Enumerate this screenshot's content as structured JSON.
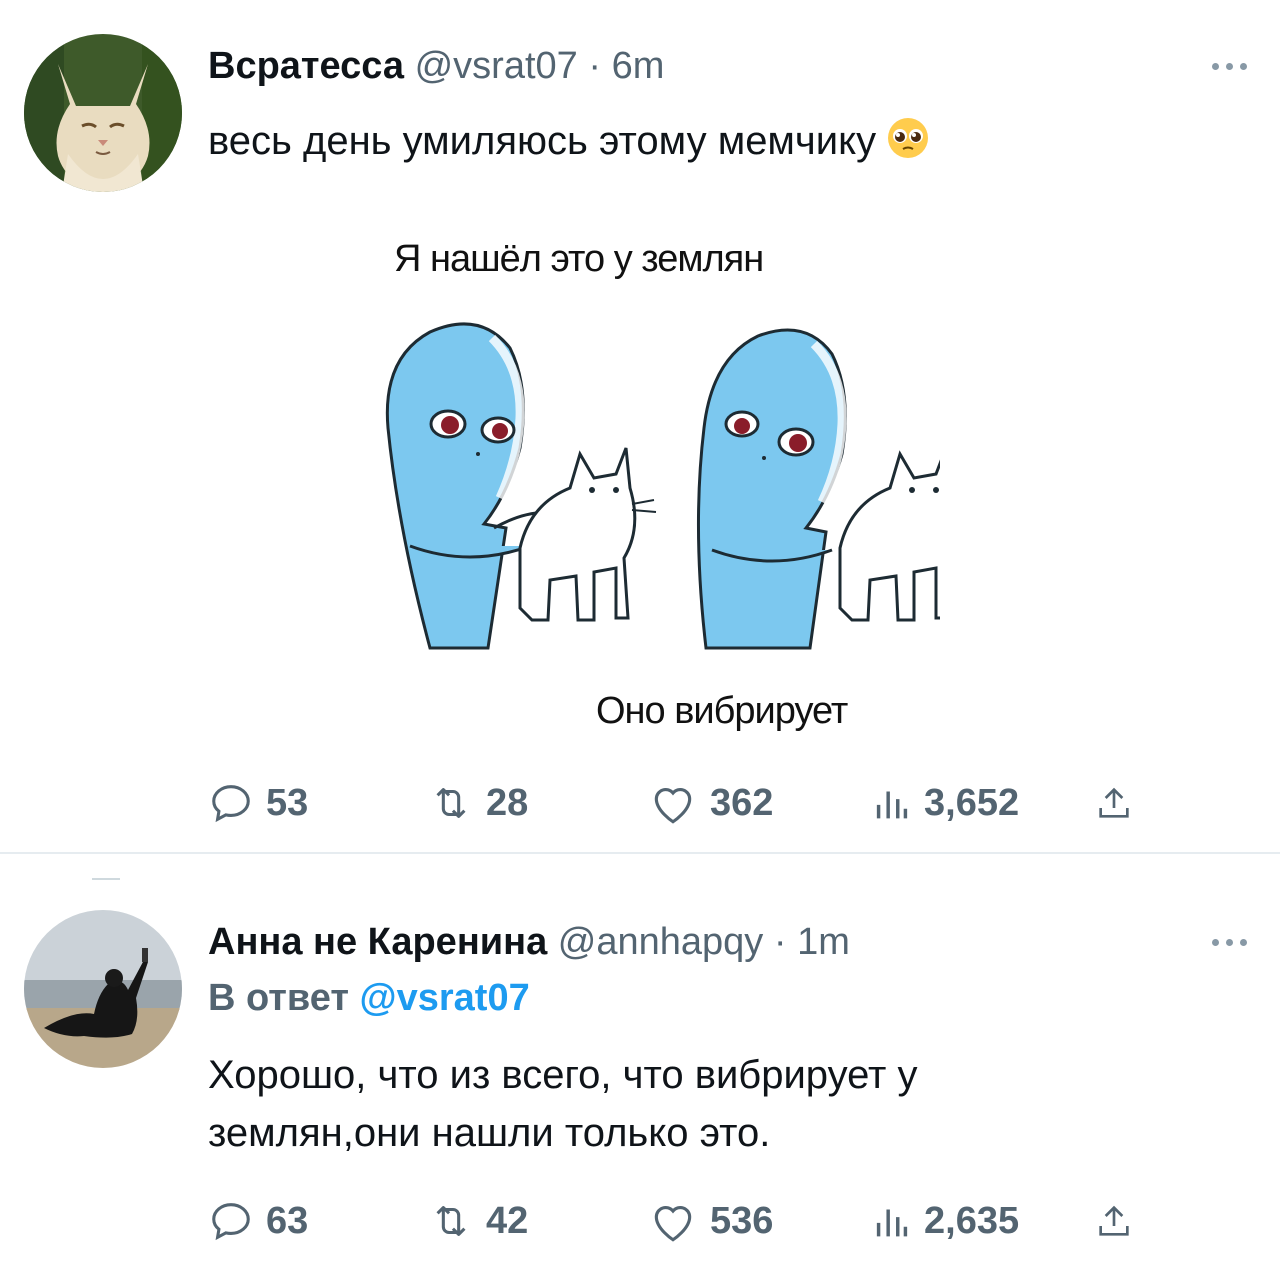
{
  "tweets": [
    {
      "author": {
        "display_name": "Всратесса",
        "handle": "@vsrat07",
        "time": "6m",
        "avatar": "cat-avatar"
      },
      "separator": "·",
      "text": "весь день умиляюсь этому мемчику",
      "emoji": "pleading-face-emoji",
      "meme": {
        "top_caption": "Я нашёл это у землян",
        "bottom_caption": "Оно вибрирует"
      },
      "stats": {
        "replies": "53",
        "retweets": "28",
        "likes": "362",
        "views": "3,652"
      }
    },
    {
      "author": {
        "display_name": "Анна не Каренина",
        "handle": "@annhapqy",
        "time": "1m",
        "avatar": "person-selfie-avatar"
      },
      "separator": "·",
      "reply_prefix": "В ответ",
      "reply_mention": "@vsrat07",
      "text_lines": [
        "Хорошо, что из всего, что вибрирует у",
        "землян,они нашли только это."
      ],
      "stats": {
        "replies": "63",
        "retweets": "42",
        "likes": "536",
        "views": "2,635"
      }
    }
  ],
  "icons": {
    "reply": "reply-bubble-icon",
    "retweet": "retweet-icon",
    "like": "heart-icon",
    "views": "views-bar-chart-icon",
    "share": "share-upload-icon",
    "more": "more-dots-icon"
  },
  "colors": {
    "text": "#0f1419",
    "secondary": "#536471",
    "accent": "#1d9bf0",
    "alien": "#7cc8ef"
  }
}
